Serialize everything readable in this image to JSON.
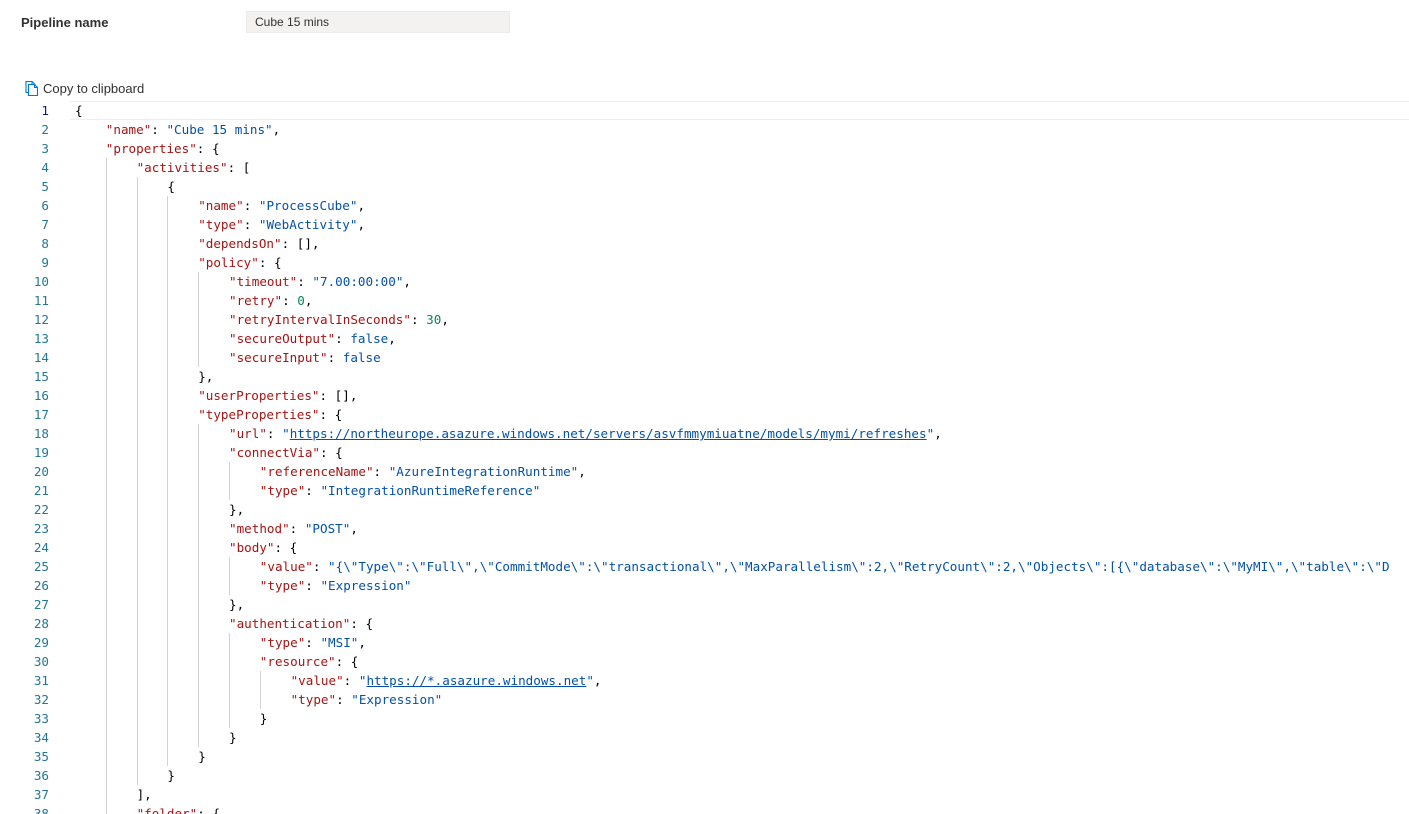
{
  "pipeline": {
    "label": "Pipeline name",
    "value": "Cube 15 mins"
  },
  "toolbar": {
    "copy_label": "Copy to clipboard",
    "copy_icon": "copy-icon"
  },
  "editor": {
    "active_line": 1,
    "lines": [
      {
        "n": "1",
        "indent": 0,
        "tokens": [
          {
            "t": "p",
            "v": "{"
          }
        ]
      },
      {
        "n": "2",
        "indent": 1,
        "tokens": [
          {
            "t": "k",
            "v": "\"name\""
          },
          {
            "t": "p",
            "v": ": "
          },
          {
            "t": "s",
            "v": "\"Cube 15 mins\""
          },
          {
            "t": "p",
            "v": ","
          }
        ]
      },
      {
        "n": "3",
        "indent": 1,
        "tokens": [
          {
            "t": "k",
            "v": "\"properties\""
          },
          {
            "t": "p",
            "v": ": {"
          }
        ]
      },
      {
        "n": "4",
        "indent": 2,
        "tokens": [
          {
            "t": "k",
            "v": "\"activities\""
          },
          {
            "t": "p",
            "v": ": ["
          }
        ]
      },
      {
        "n": "5",
        "indent": 3,
        "tokens": [
          {
            "t": "p",
            "v": "{"
          }
        ]
      },
      {
        "n": "6",
        "indent": 4,
        "tokens": [
          {
            "t": "k",
            "v": "\"name\""
          },
          {
            "t": "p",
            "v": ": "
          },
          {
            "t": "s",
            "v": "\"ProcessCube\""
          },
          {
            "t": "p",
            "v": ","
          }
        ]
      },
      {
        "n": "7",
        "indent": 4,
        "tokens": [
          {
            "t": "k",
            "v": "\"type\""
          },
          {
            "t": "p",
            "v": ": "
          },
          {
            "t": "s",
            "v": "\"WebActivity\""
          },
          {
            "t": "p",
            "v": ","
          }
        ]
      },
      {
        "n": "8",
        "indent": 4,
        "tokens": [
          {
            "t": "k",
            "v": "\"dependsOn\""
          },
          {
            "t": "p",
            "v": ": [],"
          }
        ]
      },
      {
        "n": "9",
        "indent": 4,
        "tokens": [
          {
            "t": "k",
            "v": "\"policy\""
          },
          {
            "t": "p",
            "v": ": {"
          }
        ]
      },
      {
        "n": "10",
        "indent": 5,
        "tokens": [
          {
            "t": "k",
            "v": "\"timeout\""
          },
          {
            "t": "p",
            "v": ": "
          },
          {
            "t": "s",
            "v": "\"7.00:00:00\""
          },
          {
            "t": "p",
            "v": ","
          }
        ]
      },
      {
        "n": "11",
        "indent": 5,
        "tokens": [
          {
            "t": "k",
            "v": "\"retry\""
          },
          {
            "t": "p",
            "v": ": "
          },
          {
            "t": "n",
            "v": "0"
          },
          {
            "t": "p",
            "v": ","
          }
        ]
      },
      {
        "n": "12",
        "indent": 5,
        "tokens": [
          {
            "t": "k",
            "v": "\"retryIntervalInSeconds\""
          },
          {
            "t": "p",
            "v": ": "
          },
          {
            "t": "n",
            "v": "30"
          },
          {
            "t": "p",
            "v": ","
          }
        ]
      },
      {
        "n": "13",
        "indent": 5,
        "tokens": [
          {
            "t": "k",
            "v": "\"secureOutput\""
          },
          {
            "t": "p",
            "v": ": "
          },
          {
            "t": "b",
            "v": "false"
          },
          {
            "t": "p",
            "v": ","
          }
        ]
      },
      {
        "n": "14",
        "indent": 5,
        "tokens": [
          {
            "t": "k",
            "v": "\"secureInput\""
          },
          {
            "t": "p",
            "v": ": "
          },
          {
            "t": "b",
            "v": "false"
          }
        ]
      },
      {
        "n": "15",
        "indent": 4,
        "tokens": [
          {
            "t": "p",
            "v": "},"
          }
        ]
      },
      {
        "n": "16",
        "indent": 4,
        "tokens": [
          {
            "t": "k",
            "v": "\"userProperties\""
          },
          {
            "t": "p",
            "v": ": [],"
          }
        ]
      },
      {
        "n": "17",
        "indent": 4,
        "tokens": [
          {
            "t": "k",
            "v": "\"typeProperties\""
          },
          {
            "t": "p",
            "v": ": {"
          }
        ]
      },
      {
        "n": "18",
        "indent": 5,
        "tokens": [
          {
            "t": "k",
            "v": "\"url\""
          },
          {
            "t": "p",
            "v": ": "
          },
          {
            "t": "s",
            "v": "\""
          },
          {
            "t": "su",
            "v": "https://northeurope.asazure.windows.net/servers/asvfmmymiuatne/models/mymi/refreshes"
          },
          {
            "t": "s",
            "v": "\""
          },
          {
            "t": "p",
            "v": ","
          }
        ]
      },
      {
        "n": "19",
        "indent": 5,
        "tokens": [
          {
            "t": "k",
            "v": "\"connectVia\""
          },
          {
            "t": "p",
            "v": ": {"
          }
        ]
      },
      {
        "n": "20",
        "indent": 6,
        "tokens": [
          {
            "t": "k",
            "v": "\"referenceName\""
          },
          {
            "t": "p",
            "v": ": "
          },
          {
            "t": "s",
            "v": "\"AzureIntegrationRuntime\""
          },
          {
            "t": "p",
            "v": ","
          }
        ]
      },
      {
        "n": "21",
        "indent": 6,
        "tokens": [
          {
            "t": "k",
            "v": "\"type\""
          },
          {
            "t": "p",
            "v": ": "
          },
          {
            "t": "s",
            "v": "\"IntegrationRuntimeReference\""
          }
        ]
      },
      {
        "n": "22",
        "indent": 5,
        "tokens": [
          {
            "t": "p",
            "v": "},"
          }
        ]
      },
      {
        "n": "23",
        "indent": 5,
        "tokens": [
          {
            "t": "k",
            "v": "\"method\""
          },
          {
            "t": "p",
            "v": ": "
          },
          {
            "t": "s",
            "v": "\"POST\""
          },
          {
            "t": "p",
            "v": ","
          }
        ]
      },
      {
        "n": "24",
        "indent": 5,
        "tokens": [
          {
            "t": "k",
            "v": "\"body\""
          },
          {
            "t": "p",
            "v": ": {"
          }
        ]
      },
      {
        "n": "25",
        "indent": 6,
        "tokens": [
          {
            "t": "k",
            "v": "\"value\""
          },
          {
            "t": "p",
            "v": ": "
          },
          {
            "t": "s",
            "v": "\"{\\\"Type\\\":\\\"Full\\\",\\\"CommitMode\\\":\\\"transactional\\\",\\\"MaxParallelism\\\":2,\\\"RetryCount\\\":2,\\\"Objects\\\":[{\\\"database\\\":\\\"MyMI\\\",\\\"table\\\":\\\"D"
          }
        ]
      },
      {
        "n": "26",
        "indent": 6,
        "tokens": [
          {
            "t": "k",
            "v": "\"type\""
          },
          {
            "t": "p",
            "v": ": "
          },
          {
            "t": "s",
            "v": "\"Expression\""
          }
        ]
      },
      {
        "n": "27",
        "indent": 5,
        "tokens": [
          {
            "t": "p",
            "v": "},"
          }
        ]
      },
      {
        "n": "28",
        "indent": 5,
        "tokens": [
          {
            "t": "k",
            "v": "\"authentication\""
          },
          {
            "t": "p",
            "v": ": {"
          }
        ]
      },
      {
        "n": "29",
        "indent": 6,
        "tokens": [
          {
            "t": "k",
            "v": "\"type\""
          },
          {
            "t": "p",
            "v": ": "
          },
          {
            "t": "s",
            "v": "\"MSI\""
          },
          {
            "t": "p",
            "v": ","
          }
        ]
      },
      {
        "n": "30",
        "indent": 6,
        "tokens": [
          {
            "t": "k",
            "v": "\"resource\""
          },
          {
            "t": "p",
            "v": ": {"
          }
        ]
      },
      {
        "n": "31",
        "indent": 7,
        "tokens": [
          {
            "t": "k",
            "v": "\"value\""
          },
          {
            "t": "p",
            "v": ": "
          },
          {
            "t": "s",
            "v": "\""
          },
          {
            "t": "su",
            "v": "https://*.asazure.windows.net"
          },
          {
            "t": "s",
            "v": "\""
          },
          {
            "t": "p",
            "v": ","
          }
        ]
      },
      {
        "n": "32",
        "indent": 7,
        "tokens": [
          {
            "t": "k",
            "v": "\"type\""
          },
          {
            "t": "p",
            "v": ": "
          },
          {
            "t": "s",
            "v": "\"Expression\""
          }
        ]
      },
      {
        "n": "33",
        "indent": 6,
        "tokens": [
          {
            "t": "p",
            "v": "}"
          }
        ]
      },
      {
        "n": "34",
        "indent": 5,
        "tokens": [
          {
            "t": "p",
            "v": "}"
          }
        ]
      },
      {
        "n": "35",
        "indent": 4,
        "tokens": [
          {
            "t": "p",
            "v": "}"
          }
        ]
      },
      {
        "n": "36",
        "indent": 3,
        "tokens": [
          {
            "t": "p",
            "v": "}"
          }
        ]
      },
      {
        "n": "37",
        "indent": 2,
        "tokens": [
          {
            "t": "p",
            "v": "],"
          }
        ]
      },
      {
        "n": "38",
        "indent": 2,
        "tokens": [
          {
            "t": "k",
            "v": "\"folder\""
          },
          {
            "t": "p",
            "v": ": {"
          }
        ]
      }
    ]
  },
  "colors": {
    "key": "#a31515",
    "string": "#0451a5",
    "number": "#098658",
    "line_number": "#237893",
    "guide": "#d3d3d3"
  }
}
